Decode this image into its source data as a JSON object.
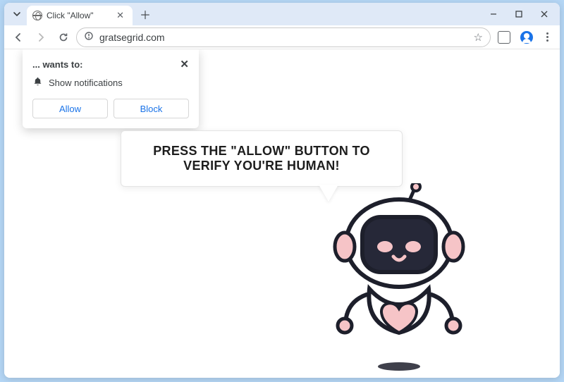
{
  "tab": {
    "title": "Click \"Allow\""
  },
  "address": {
    "url": "gratsegrid.com"
  },
  "permission": {
    "header": "... wants to:",
    "item": "Show notifications",
    "allow": "Allow",
    "block": "Block"
  },
  "page": {
    "headline": "PRESS THE \"ALLOW\" BUTTON TO VERIFY YOU'RE HUMAN!"
  }
}
